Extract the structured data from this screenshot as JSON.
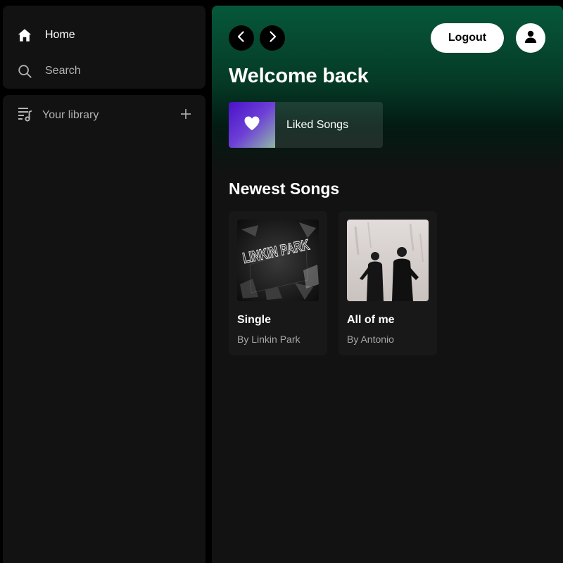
{
  "sidebar": {
    "nav": {
      "home_label": "Home",
      "search_label": "Search"
    },
    "library": {
      "title": "Your library"
    }
  },
  "header": {
    "logout_label": "Logout"
  },
  "main": {
    "welcome": "Welcome back",
    "liked": {
      "label": "Liked Songs"
    },
    "newest": {
      "title": "Newest Songs",
      "songs": [
        {
          "title": "Single",
          "artist": "By Linkin Park",
          "cover_text": "LINKIN PARK"
        },
        {
          "title": "All of me",
          "artist": "By Antonio"
        }
      ]
    }
  },
  "icons": {
    "home": "home-icon",
    "search": "search-icon",
    "library": "library-icon",
    "add": "plus-icon",
    "back": "chevron-left-icon",
    "forward": "chevron-right-icon",
    "user": "user-icon",
    "heart": "heart-icon"
  },
  "colors": {
    "accent_green": "#06583a",
    "liked_gradient_start": "#4a12c9",
    "panel": "#121212",
    "card": "#181818",
    "muted_text": "#b3b3b3"
  }
}
